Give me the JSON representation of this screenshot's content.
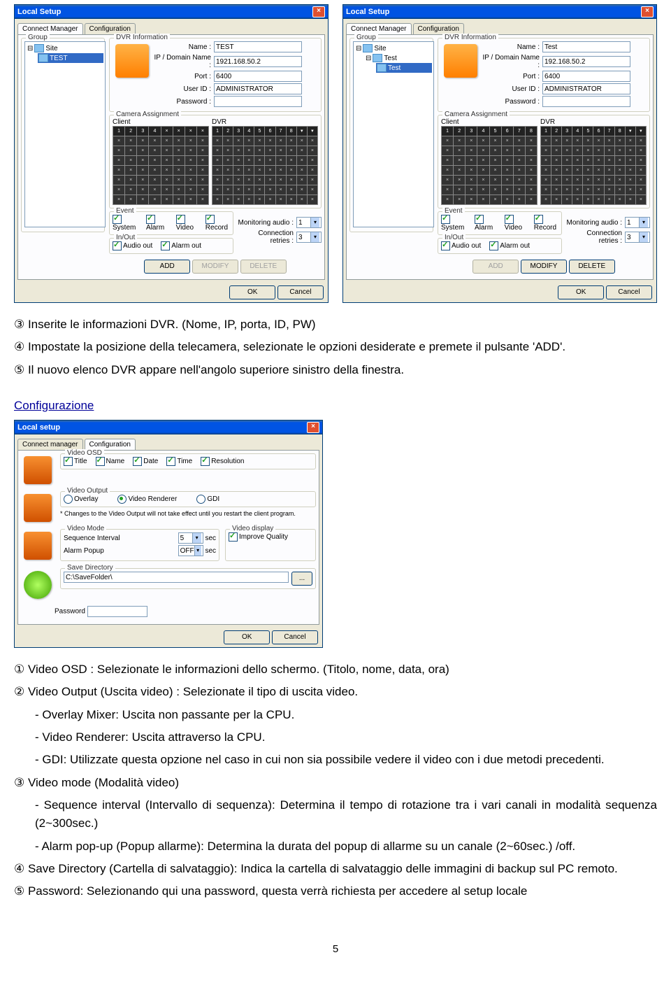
{
  "dialogs": {
    "left": {
      "title": "Local Setup",
      "tabs": [
        "Connect Manager",
        "Configuration"
      ],
      "tree": {
        "root": "Site",
        "child": "TEST",
        "selected": true
      },
      "dvr": {
        "name": "TEST",
        "ip": "1921.168.50.2",
        "port": "6400",
        "user": "ADMINISTRATOR",
        "pw": ""
      },
      "labels": {
        "name": "Name :",
        "ip": "IP / Domain Name :",
        "port": "Port :",
        "user": "User ID :",
        "pw": "Password :"
      },
      "groups": {
        "dvrinfo": "DVR Information",
        "camassign": "Camera Assignment",
        "client": "Client",
        "dvr_g": "DVR",
        "event": "Event",
        "inout": "In/Out",
        "group": "Group"
      },
      "event": {
        "system": "System",
        "alarm": "Alarm",
        "video": "Video",
        "record": "Record"
      },
      "inout": {
        "audio": "Audio out",
        "alarm": "Alarm out"
      },
      "monitor": {
        "audio": "Monitoring audio :",
        "audio_v": "1",
        "retries": "Connection retries :",
        "retries_v": "3"
      },
      "buttons": {
        "add": "ADD",
        "modify": "MODIFY",
        "delete": "DELETE",
        "ok": "OK",
        "cancel": "Cancel"
      },
      "client_hdr": [
        "1",
        "2",
        "3",
        "4"
      ]
    },
    "right": {
      "title": "Local Setup",
      "tree": {
        "root": "Site",
        "child": "Test",
        "sub": "Test"
      },
      "dvr": {
        "name": "Test",
        "ip": "192.168.50.2",
        "port": "6400",
        "user": "ADMINISTRATOR",
        "pw": ""
      },
      "client_hdr": [
        "1",
        "2",
        "3",
        "4",
        "5",
        "6",
        "7",
        "8"
      ]
    },
    "config": {
      "title": "Local setup",
      "tabs": [
        "Connect manager",
        "Configuration"
      ],
      "osd": {
        "title": "Video OSD",
        "opts": [
          "Title",
          "Name",
          "Date",
          "Time",
          "Resolution"
        ]
      },
      "output": {
        "title": "Video Output",
        "opts": [
          "Overlay",
          "Video Renderer",
          "GDI"
        ],
        "selected": 1,
        "note": "* Changes to the Video Output will not take effect until you restart the client program."
      },
      "mode": {
        "title": "Video Mode",
        "seq_l": "Sequence Interval",
        "seq_v": "5",
        "seq_u": "sec",
        "alarm_l": "Alarm Popup",
        "alarm_v": "OFF",
        "alarm_u": "sec"
      },
      "display": {
        "title": "Video display",
        "improve": "Improve Quality"
      },
      "save": {
        "title": "Save Directory",
        "path": "C:\\SaveFolder\\"
      },
      "pw": {
        "label": "Password"
      },
      "buttons": {
        "ok": "OK",
        "cancel": "Cancel"
      }
    }
  },
  "text": {
    "l1": "③ Inserite le informazioni DVR. (Nome, IP, porta, ID, PW)",
    "l2": "④ Impostate la posizione della telecamera, selezionate le opzioni desiderate e premete il pulsante 'ADD'.",
    "l3": "⑤ Il nuovo elenco DVR appare nell'angolo superiore sinistro della finestra.",
    "cfg_h": "Configurazione",
    "b1": "① Video OSD : Selezionate le informazioni dello schermo. (Titolo, nome, data, ora)",
    "b2": "② Video Output (Uscita video) : Selezionate il tipo di uscita video.",
    "b2a": "- Overlay Mixer: Uscita non passante per la CPU.",
    "b2b": "- Video Renderer: Uscita attraverso la CPU.",
    "b2c": "- GDI: Utilizzate questa opzione nel caso in cui non sia possibile vedere il video con i due metodi precedenti.",
    "b3": "③ Video mode (Modalità video)",
    "b3a": "- Sequence interval (Intervallo di sequenza): Determina il tempo di rotazione tra i vari canali in modalità sequenza (2~300sec.)",
    "b3b": "- Alarm pop-up (Popup allarme): Determina la durata del popup di allarme su un canale (2~60sec.) /off.",
    "b4": "④ Save Directory (Cartella di salvataggio): Indica la cartella di salvataggio delle immagini di backup sul PC remoto.",
    "b5": "⑤ Password: Selezionando qui una password, questa verrà richiesta per accedere al setup locale",
    "page": "5"
  }
}
